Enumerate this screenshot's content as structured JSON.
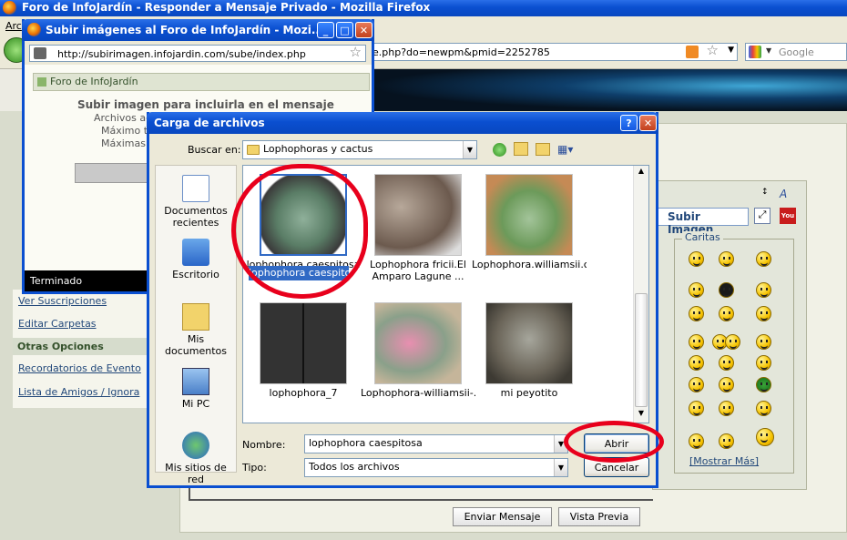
{
  "main_window": {
    "title": "Foro de InfoJardín - Responder a Mensaje Privado - Mozilla Firefox",
    "menu_partial": "Arc",
    "url_tail": "e.php?do=newpm&pmid=2252785",
    "search_placeholder": "Google",
    "sidebar": {
      "links_top": [
        "Ver Suscripciones",
        "Editar Carpetas"
      ],
      "section_other": "Otras Opciones",
      "links_other": [
        "Recordatorios de Evento",
        "Lista de Amigos / Ignora"
      ]
    },
    "upload_image_button": "Subir Imagen",
    "smilies_title": "Caritas",
    "more_smilies": "[Mostrar Más]",
    "send_button": "Enviar Mensaje",
    "preview_button": "Vista Previa"
  },
  "popup_window": {
    "title": "Subir imágenes al Foro de InfoJardín - Mozi...",
    "url": "http://subirimagen.infojardin.com/sube/index.php",
    "header": "Foro de InfoJardín",
    "heading": "Subir imagen para incluirla en el mensaje",
    "lines": [
      "Archivos ac",
      "Máximo ta",
      "Máximas s"
    ],
    "status": "Terminado"
  },
  "file_dialog": {
    "title": "Carga de archivos",
    "look_in_label": "Buscar en:",
    "look_in_value": "Lophophoras y cactus",
    "places": [
      {
        "label": "Documentos recientes",
        "icon": "recent-documents-icon"
      },
      {
        "label": "Escritorio",
        "icon": "desktop-icon"
      },
      {
        "label": "Mis documentos",
        "icon": "my-documents-icon"
      },
      {
        "label": "Mi PC",
        "icon": "my-computer-icon"
      },
      {
        "label": "Mis sitios de red",
        "icon": "network-places-icon"
      }
    ],
    "files": [
      {
        "name": "lophophora caespitosa",
        "selected": true
      },
      {
        "name": "Lophophora fricii.El Amparo Lagune ...",
        "selected": false
      },
      {
        "name": "Lophophora.williamsii.c...",
        "selected": false
      },
      {
        "name": "lophophora_7",
        "selected": false
      },
      {
        "name": "Lophophora-williamsii-...",
        "selected": false
      },
      {
        "name": "mi peyotito",
        "selected": false
      }
    ],
    "filename_label": "Nombre:",
    "filename_value": "lophophora caespitosa",
    "filetype_label": "Tipo:",
    "filetype_value": "Todos los archivos",
    "open_button": "Abrir",
    "cancel_button": "Cancelar"
  }
}
